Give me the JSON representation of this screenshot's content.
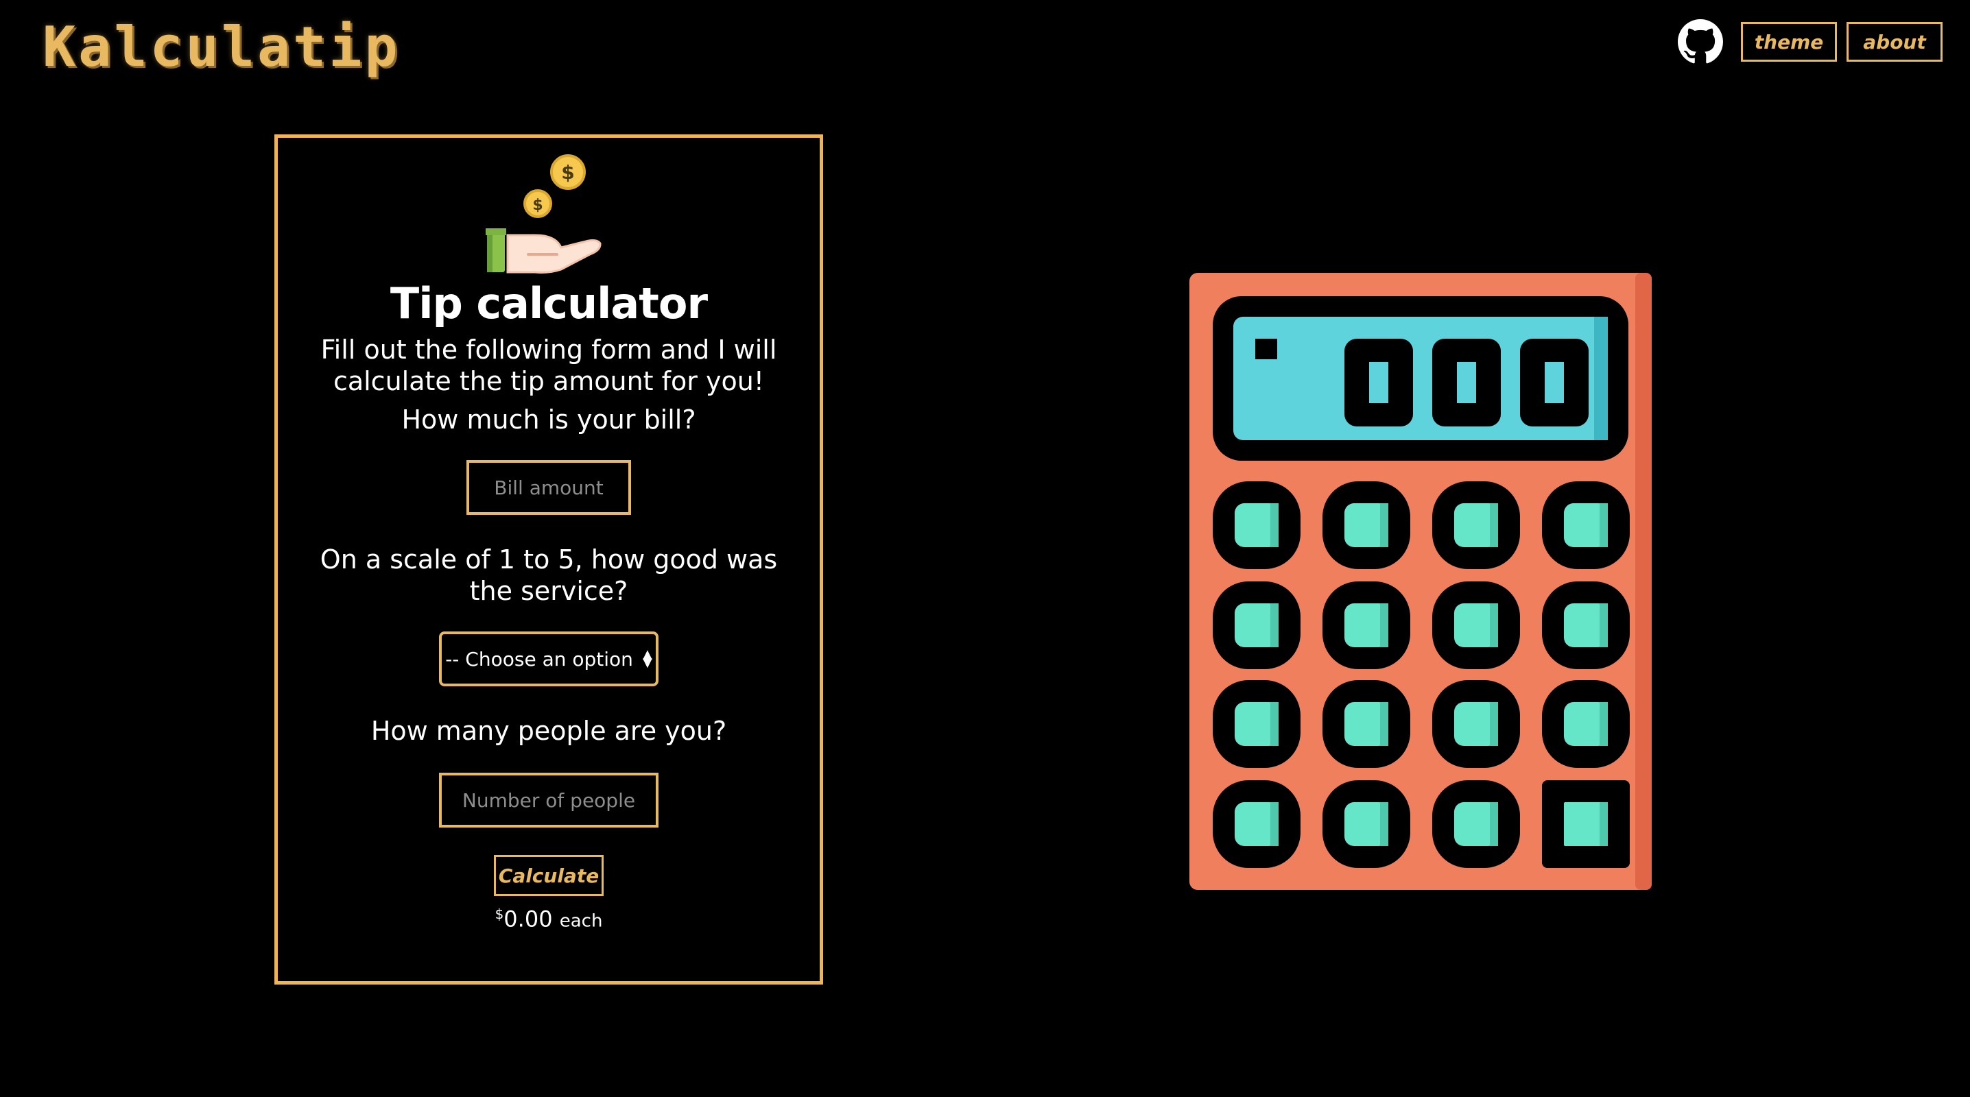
{
  "header": {
    "logo": "Kalculatip",
    "nav": {
      "github_icon": "github-icon",
      "theme_label": "theme",
      "about_label": "about"
    }
  },
  "card": {
    "icon": "hand-with-coins-icon",
    "title": "Tip calculator",
    "intro": "Fill out the following form and I will calculate the tip amount for you!",
    "bill_question": "How much is your bill?",
    "bill_placeholder": "Bill amount",
    "service_question": "On a scale of 1 to 5, how good was the service?",
    "service_select_value": "-- Choose an option",
    "people_question": "How many people are you?",
    "people_placeholder": "Number of people",
    "calculate_label": "Calculate",
    "result_currency": "$",
    "result_amount": "0.00",
    "result_suffix": "each"
  },
  "illustration": {
    "icon": "calculator-icon",
    "display_digits": [
      "0",
      "0",
      "0"
    ]
  },
  "colors": {
    "background": "#000000",
    "accent": "#e8b961",
    "card_border": "#f1b451",
    "calculator_body": "#f07f5e",
    "calculator_screen": "#5ed3dc",
    "calculator_keys": "#66e6c8"
  }
}
